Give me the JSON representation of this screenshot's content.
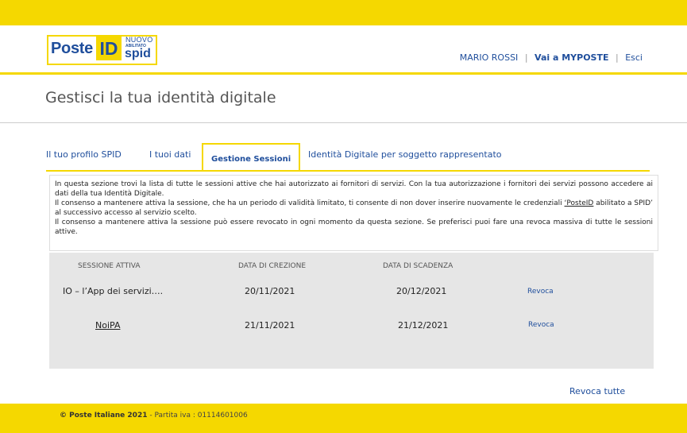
{
  "brand": {
    "poste": "Poste",
    "id": "ID",
    "nuovo": "NUOVO",
    "abilitato": "ABILITATO",
    "spid": "spid",
    "primary_color": "#1f4e9c",
    "accent_color": "#f5d800"
  },
  "header": {
    "user_name": "MARIO ROSSI",
    "sep": "|",
    "my_poste": "Vai a MYPOSTE",
    "exit": "Esci"
  },
  "page": {
    "title": "Gestisci la tua identità digitale"
  },
  "tabs": [
    {
      "label": "Il tuo profilo SPID",
      "active": false
    },
    {
      "label": "I tuoi dati",
      "active": false
    },
    {
      "label": "Gestione Sessioni",
      "active": true
    },
    {
      "label": "Identità Digitale per soggetto rappresentato",
      "active": false
    }
  ],
  "info": {
    "p1": "In questa sezione trovi la lista di tutte le sessioni attive che hai autorizzato ai fornitori di servizi. Con la tua autorizzazione i fornitori dei servizi possono accedere ai dati della tua Identità Digitale.",
    "p2a": "Il consenso a mantenere attiva la sessione, che ha un periodo di validità limitato, ti consente di non dover inserire nuovamente le credenziali ",
    "p2b": "‘PosteID",
    "p2c": " abilitato a SPID’ al successivo accesso al servizio scelto.",
    "p3": "Il consenso a mantenere attiva la sessione può essere revocato in ogni momento da questa sezione. Se preferisci puoi fare una revoca massiva di tutte le sessioni attive."
  },
  "table": {
    "headers": [
      "SESSIONE ATTIVA",
      "DATA DI CREZIONE",
      "DATA DI SCADENZA"
    ],
    "rows": [
      {
        "session": "IO – l’App dei servizi….",
        "created": "20/11/2021",
        "expires": "20/12/2021",
        "action": "Revoca"
      },
      {
        "session": "NoiPA",
        "created": "21/11/2021",
        "expires": "21/12/2021",
        "action": "Revoca"
      }
    ]
  },
  "revoke_all": "Revoca tutte",
  "footer": {
    "copyright": "© Poste Italiane 2021",
    "vat": " - Partita iva : 01114601006"
  }
}
